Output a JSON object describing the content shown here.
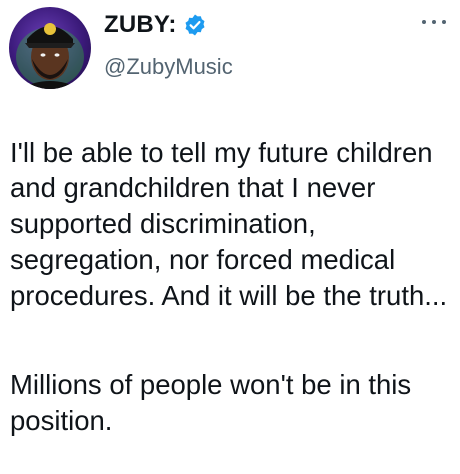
{
  "tweet": {
    "author": {
      "display_name": "ZUBY:",
      "handle": "@ZubyMusic",
      "verified": true,
      "avatar_icon": "profile-photo",
      "verified_icon": "verified-badge-icon",
      "verified_color": "#1d9bf0"
    },
    "more_icon": "more-options-icon",
    "paragraphs": [
      "I'll be able to tell my future children and grandchildren that I never supported discrimination, segregation, nor forced medical procedures. And it will be the truth...",
      "Millions of people won't be in this position."
    ]
  }
}
